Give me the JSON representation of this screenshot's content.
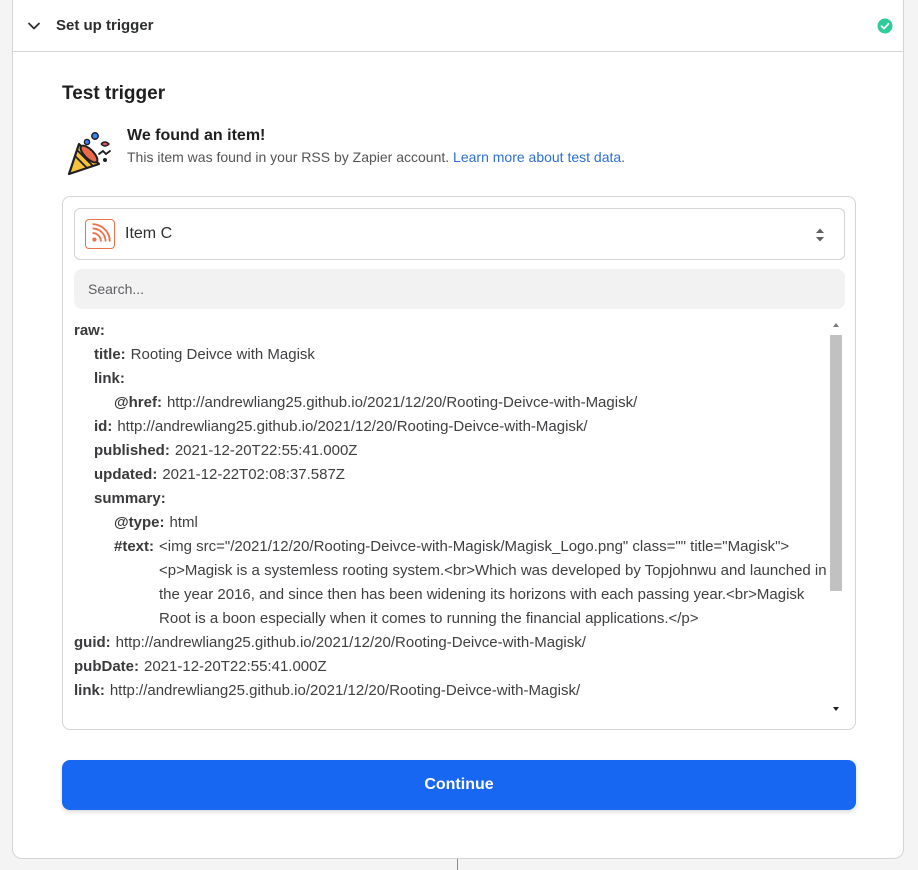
{
  "header": {
    "title": "Set up trigger",
    "status": "complete",
    "icons": {
      "collapse": "chevron-down-icon",
      "status": "check-circle-icon"
    }
  },
  "section": {
    "title": "Test trigger"
  },
  "found": {
    "icon": "party-popper-icon",
    "title": "We found an item!",
    "description": "This item was found in your RSS by Zapier account.",
    "link_text": "Learn more about test data",
    "trailing": "."
  },
  "item_select": {
    "icon": "rss-icon",
    "selected": "Item C"
  },
  "search": {
    "placeholder": "Search..."
  },
  "data_rows": [
    {
      "level": 0,
      "key": "raw:",
      "value": ""
    },
    {
      "level": 1,
      "key": "title:",
      "value": "Rooting Deivce with Magisk"
    },
    {
      "level": 1,
      "key": "link:",
      "value": ""
    },
    {
      "level": 2,
      "key": "@href:",
      "value": "http://andrewliang25.github.io/2021/12/20/Rooting-Deivce-with-Magisk/"
    },
    {
      "level": 1,
      "key": "id:",
      "value": "http://andrewliang25.github.io/2021/12/20/Rooting-Deivce-with-Magisk/"
    },
    {
      "level": 1,
      "key": "published:",
      "value": "2021-12-20T22:55:41.000Z"
    },
    {
      "level": 1,
      "key": "updated:",
      "value": "2021-12-22T02:08:37.587Z"
    },
    {
      "level": 1,
      "key": "summary:",
      "value": ""
    },
    {
      "level": 2,
      "key": "@type:",
      "value": "html"
    },
    {
      "level": 2,
      "key": "#text:",
      "value": "<img src=\"/2021/12/20/Rooting-Deivce-with-Magisk/Magisk_Logo.png\" class=\"\" title=\"Magisk\"><p>Magisk is a systemless rooting system.<br>Which was developed by Topjohnwu and launched in the year 2016, and since then has been widening its horizons with each passing year.<br>Magisk Root is a boon especially when it comes to running the financial applications.</p>",
      "multi": true
    },
    {
      "level": 0,
      "key": "guid:",
      "value": "http://andrewliang25.github.io/2021/12/20/Rooting-Deivce-with-Magisk/"
    },
    {
      "level": 0,
      "key": "pubDate:",
      "value": "2021-12-20T22:55:41.000Z"
    },
    {
      "level": 0,
      "key": "link:",
      "value": "http://andrewliang25.github.io/2021/12/20/Rooting-Deivce-with-Magisk/"
    }
  ],
  "continue_button": {
    "label": "Continue"
  },
  "colors": {
    "primary": "#1767f2",
    "success": "#2ecc9a",
    "link": "#2d6fd4",
    "rss": "#e8734a"
  }
}
